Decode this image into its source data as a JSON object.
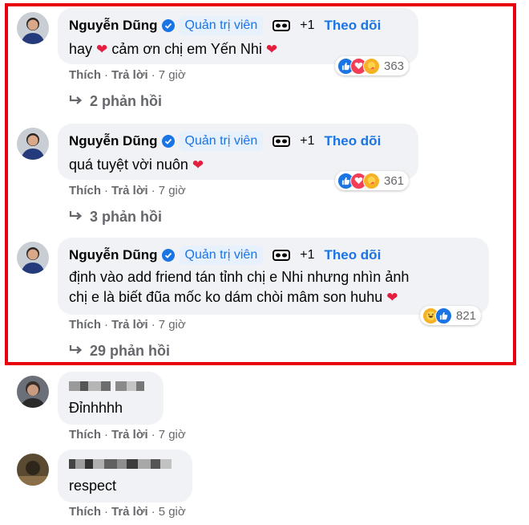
{
  "colors": {
    "highlight": "#e8000d",
    "accent": "#1b74e4",
    "bubble": "#f0f2f5",
    "meta": "#65676b"
  },
  "comments": [
    {
      "author": "Nguyễn Dũng",
      "badge": "Quản trị viên",
      "plus": "+1",
      "follow": "Theo dõi",
      "text": "hay",
      "text2": "cảm ơn chị em Yến Nhi",
      "reaction_count": "363",
      "like": "Thích",
      "reply": "Trả lời",
      "time": "7 giờ",
      "replies": "2 phản hồi"
    },
    {
      "author": "Nguyễn Dũng",
      "badge": "Quản trị viên",
      "plus": "+1",
      "follow": "Theo dõi",
      "text": "quá tuyệt vời nuôn",
      "reaction_count": "361",
      "like": "Thích",
      "reply": "Trả lời",
      "time": "7 giờ",
      "replies": "3 phản hồi"
    },
    {
      "author": "Nguyễn Dũng",
      "badge": "Quản trị viên",
      "plus": "+1",
      "follow": "Theo dõi",
      "text_line1": "định vào add friend tán tỉnh chị e Nhi nhưng nhìn ảnh",
      "text_line2": "chị e là biết đũa mốc ko dám chòi mâm son huhu",
      "reaction_count": "821",
      "like": "Thích",
      "reply": "Trả lời",
      "time": "7 giờ",
      "replies": "29 phản hồi"
    },
    {
      "text": "Đỉnhhhh",
      "like": "Thích",
      "reply": "Trả lời",
      "time": "7 giờ"
    },
    {
      "text": "respect",
      "like": "Thích",
      "reply": "Trả lời",
      "time": "5 giờ"
    }
  ],
  "icons": [
    "avatar",
    "verified-badge-icon",
    "mask-icon",
    "like-reaction-icon",
    "love-reaction-icon",
    "care-reaction-icon",
    "haha-reaction-icon",
    "reply-arrow-icon",
    "heart-emoji"
  ]
}
